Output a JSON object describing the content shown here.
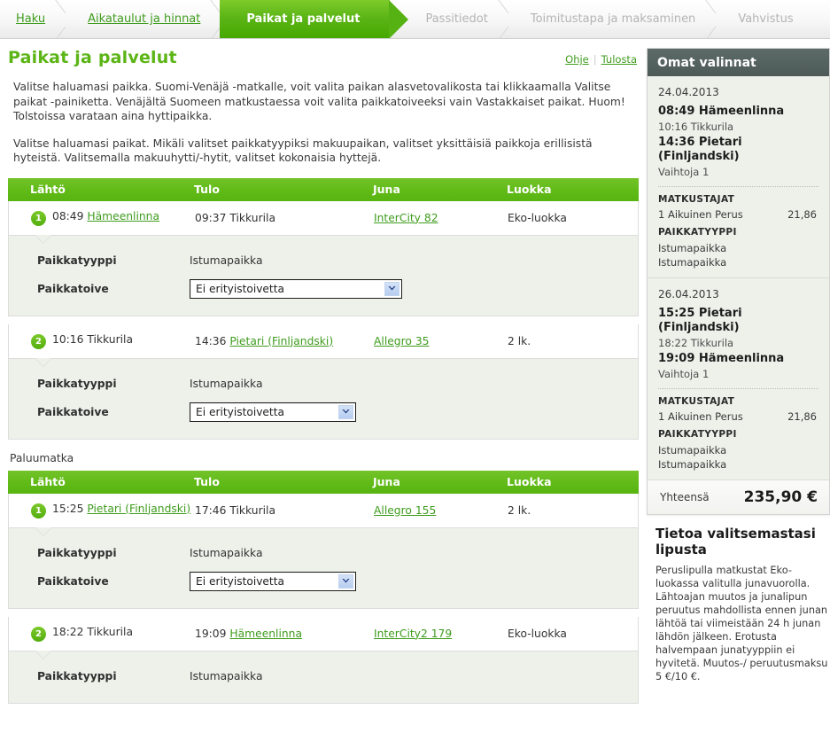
{
  "stepnav": {
    "steps": [
      {
        "label": "Haku",
        "state": "done"
      },
      {
        "label": "Aikataulut ja hinnat",
        "state": "done"
      },
      {
        "label": "Paikat ja palvelut",
        "state": "active"
      },
      {
        "label": "Passitiedot",
        "state": "upcoming"
      },
      {
        "label": "Toimitustapa ja maksaminen",
        "state": "upcoming"
      },
      {
        "label": "Vahvistus",
        "state": "upcoming"
      }
    ]
  },
  "main": {
    "title": "Paikat ja palvelut",
    "links": {
      "help": "Ohje",
      "print": "Tulosta",
      "separator": "|"
    },
    "intro1": "Valitse haluamasi paikka. Suomi-Venäjä -matkalle, voit valita paikan alasvetovalikosta tai klikkaamalla Valitse paikat -painiketta. Venäjältä Suomeen matkustaessa voit valita paikkatoiveeksi vain Vastakkaiset paikat. Huom! Tolstoissa varataan aina hyttipaikka.",
    "intro2": "Valitse haluamasi paikat. Mikäli valitset paikkatyypiksi makuupaikan, valitset yksittäisiä paikkoja erillisistä hyteistä. Valitsemalla makuuhytti/-hytit, valitset kokonaisia hyttejä.",
    "columns": {
      "departure": "Lähtö",
      "arrival": "Tulo",
      "train": "Juna",
      "class": "Luokka"
    },
    "detail_labels": {
      "seat_type": "Paikkatyyppi",
      "seat_wish": "Paikkatoive"
    },
    "return_heading": "Paluumatka",
    "outbound_legs": [
      {
        "number": "1",
        "dep_time": "08:49",
        "dep_station": "Hämeenlinna",
        "arr_time": "09:37",
        "arr_station": "Tikkurila",
        "arr_is_link": false,
        "train": "InterCity 82",
        "class": "Eko-luokka",
        "seat_type": "Istumapaikka",
        "seat_wish": "Ei erityistoivetta",
        "select_width": "wide"
      },
      {
        "number": "2",
        "dep_time": "10:16",
        "dep_station": "Tikkurila",
        "dep_is_link": false,
        "arr_time": "14:36",
        "arr_station": "Pietari (Finljandski)",
        "arr_is_link": true,
        "train": "Allegro 35",
        "class": "2 lk.",
        "seat_type": "Istumapaikka",
        "seat_wish": "Ei erityistoivetta",
        "select_width": "narrow"
      }
    ],
    "return_legs": [
      {
        "number": "1",
        "dep_time": "15:25",
        "dep_station": "Pietari (Finljandski)",
        "arr_time": "17:46",
        "arr_station": "Tikkurila",
        "arr_is_link": false,
        "train": "Allegro 155",
        "class": "2 lk.",
        "seat_type": "Istumapaikka",
        "seat_wish": "Ei erityistoivetta",
        "select_width": "narrow"
      },
      {
        "number": "2",
        "dep_time": "18:22",
        "dep_station": "Tikkurila",
        "dep_is_link": false,
        "arr_time": "19:09",
        "arr_station": "Hämeenlinna",
        "arr_is_link": true,
        "train": "InterCity2 179",
        "class": "Eko-luokka",
        "seat_type": "Istumapaikka",
        "seat_wish": "",
        "select_width": "narrow"
      }
    ]
  },
  "sidebar": {
    "panel_title": "Omat valinnat",
    "trips": [
      {
        "date": "24.04.2013",
        "line1": "08:49 Hämeenlinna",
        "line2": "10:16 Tikkurila",
        "line3": "14:36 Pietari (Finljandski)",
        "changes": "Vaihtoja 1",
        "pax_title": "MATKUSTAJAT",
        "pax_label": "1 Aikuinen Perus",
        "pax_amount": "21,86",
        "seat_title": "PAIKKATYYPPI",
        "seat1": "Istumapaikka",
        "seat2": "Istumapaikka"
      },
      {
        "date": "26.04.2013",
        "line1": "15:25 Pietari (Finljandski)",
        "line2": "18:22 Tikkurila",
        "line3": "19:09 Hämeenlinna",
        "changes": "Vaihtoja 1",
        "pax_title": "MATKUSTAJAT",
        "pax_label": "1 Aikuinen Perus",
        "pax_amount": "21,86",
        "seat_title": "PAIKKATYYPPI",
        "seat1": "Istumapaikka",
        "seat2": "Istumapaikka"
      }
    ],
    "total_label": "Yhteensä",
    "total_value": "235,90 €",
    "info": {
      "title": "Tietoa valitsemastasi lipusta",
      "body": "Peruslipulla matkustat Eko-luokassa valitulla junavuorolla. Lähtoajan muutos ja junalipun peruutus mahdollista ennen junan lähtöä tai viimeistään 24 h junan lähdön jälkeen. Erotusta halvempaan junatyyppiin ei hyvitetä. Muutos-/ peruutusmaksu 5 €/10 €."
    }
  },
  "colors": {
    "brand_green": "#5cb516",
    "link_green": "#3f9c1e",
    "panel_head": "#4d5a57",
    "detail_bg": "#eef1ea"
  }
}
